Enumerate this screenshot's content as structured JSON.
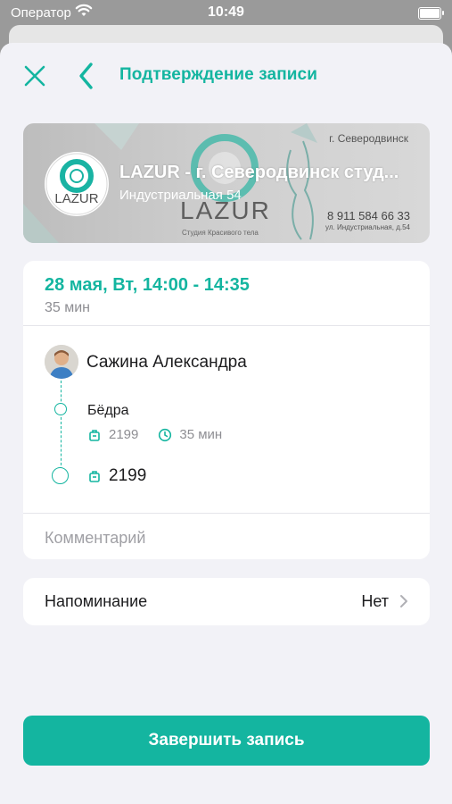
{
  "status_bar": {
    "carrier": "Оператор",
    "time": "10:49"
  },
  "header": {
    "title": "Подтверждение записи"
  },
  "salon": {
    "name": "LAZUR - г. Северодвинск студ...",
    "address": "Индустриальная 54",
    "banner": {
      "city": "г. Северодвинск",
      "brand": "LAZUR",
      "studio": "Студия Красивого тела",
      "phone": "8 911 584 66 33",
      "address": "ул. Индустриальная, д.54"
    }
  },
  "appointment": {
    "datetime": "28 мая, Вт, 14:00 - 14:35",
    "duration": "35 мин",
    "master": "Сажина Александра",
    "service": {
      "name": "Бёдра",
      "price": "2199",
      "duration": "35 мин"
    },
    "total": "2199",
    "comment_placeholder": "Комментарий"
  },
  "reminder": {
    "label": "Напоминание",
    "value": "Нет"
  },
  "actions": {
    "submit_label": "Завершить запись"
  },
  "colors": {
    "accent": "#14b5a0",
    "background": "#f2f2f7"
  },
  "icons": [
    "wifi-icon",
    "battery-icon",
    "close-icon",
    "back-icon",
    "price-tag-icon",
    "clock-icon",
    "chevron-right-icon"
  ]
}
